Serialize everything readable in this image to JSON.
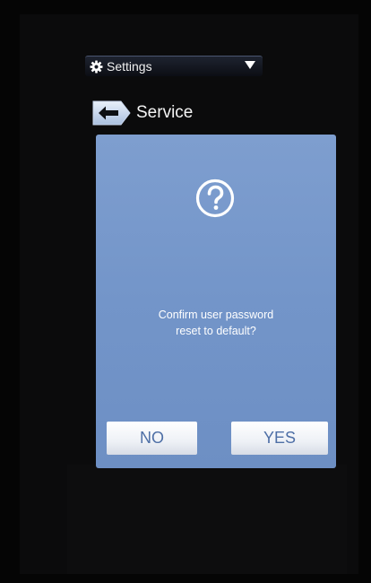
{
  "menu": {
    "label": "Settings",
    "gear_icon": "gear-icon",
    "arrow_icon": "chevron-down-icon"
  },
  "header": {
    "title": "Service",
    "back_icon": "arrow-left-icon"
  },
  "dialog": {
    "icon": "question-icon",
    "message_line1": "Confirm user password",
    "message_line2": "reset to default?",
    "no_label": "NO",
    "yes_label": "YES"
  },
  "colors": {
    "dialog_bg": "#7395c9",
    "button_text": "#4e6fa6",
    "screen_bg": "#0b0b0c"
  }
}
